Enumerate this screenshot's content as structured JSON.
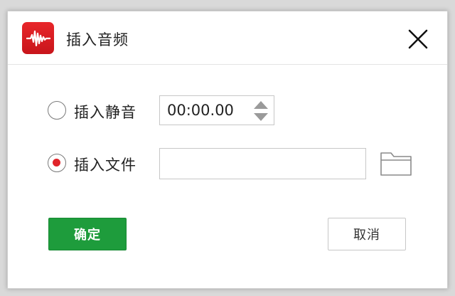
{
  "dialog": {
    "title": "插入音频",
    "app_icon": "audio-waveform-icon",
    "close_icon": "close-icon"
  },
  "options": {
    "silence": {
      "label": "插入静音",
      "checked": false,
      "time_value": "00:00.00"
    },
    "file": {
      "label": "插入文件",
      "checked": true,
      "path_value": "",
      "folder_icon": "folder-icon"
    }
  },
  "buttons": {
    "ok_label": "确定",
    "cancel_label": "取消"
  },
  "colors": {
    "accent_red": "#e0242a",
    "ok_green": "#1e9c3c"
  }
}
